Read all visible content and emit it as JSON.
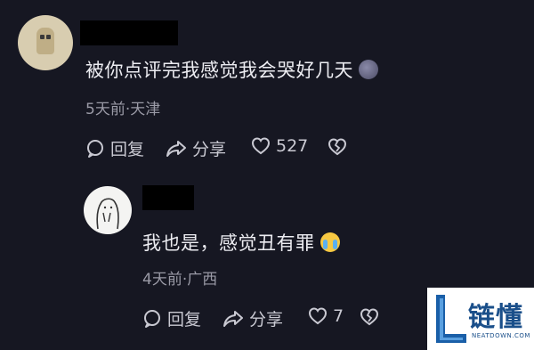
{
  "comments": [
    {
      "text": "被你点评完我感觉我会哭好几天",
      "emoji": "new-moon-face",
      "meta": "5天前·天津",
      "reply_label": "回复",
      "share_label": "分享",
      "like_count": "527"
    },
    {
      "text": "我也是，感觉丑有罪",
      "emoji": "loudly-crying-face",
      "meta": "4天前·广西",
      "reply_label": "回复",
      "share_label": "分享",
      "like_count": "7"
    }
  ],
  "watermark": {
    "name": "链懂",
    "sub": "NEATDOWN.COM"
  }
}
